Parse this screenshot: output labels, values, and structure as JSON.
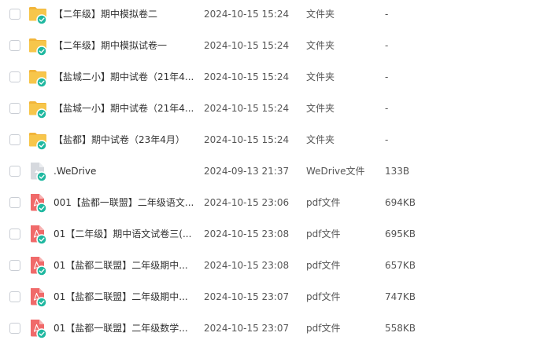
{
  "files": [
    {
      "name": "【二年级】期中模拟卷二",
      "date": "2024-10-15 15:24",
      "type": "文件夹",
      "size": "-",
      "icon": "folder-icon"
    },
    {
      "name": "【二年级】期中模拟试卷一",
      "date": "2024-10-15 15:24",
      "type": "文件夹",
      "size": "-",
      "icon": "folder-icon"
    },
    {
      "name": "【盐城二小】期中试卷（21年4...",
      "date": "2024-10-15 15:24",
      "type": "文件夹",
      "size": "-",
      "icon": "folder-icon"
    },
    {
      "name": "【盐城一小】期中试卷（21年4...",
      "date": "2024-10-15 15:24",
      "type": "文件夹",
      "size": "-",
      "icon": "folder-icon"
    },
    {
      "name": "【盐都】期中试卷（23年4月）",
      "date": "2024-10-15 15:24",
      "type": "文件夹",
      "size": "-",
      "icon": "folder-icon"
    },
    {
      "name": ".WeDrive",
      "date": "2024-09-13 21:37",
      "type": "WeDrive文件",
      "size": "133B",
      "icon": "generic-file-icon"
    },
    {
      "name": "001【盐都一联盟】二年级语文...",
      "date": "2024-10-15 23:06",
      "type": "pdf文件",
      "size": "694KB",
      "icon": "pdf-icon"
    },
    {
      "name": "01【二年级】期中语文试卷三(...",
      "date": "2024-10-15 23:08",
      "type": "pdf文件",
      "size": "695KB",
      "icon": "pdf-icon"
    },
    {
      "name": "01【盐都二联盟】二年级期中...",
      "date": "2024-10-15 23:08",
      "type": "pdf文件",
      "size": "657KB",
      "icon": "pdf-icon"
    },
    {
      "name": "01【盐都二联盟】二年级期中...",
      "date": "2024-10-15 23:07",
      "type": "pdf文件",
      "size": "747KB",
      "icon": "pdf-icon"
    },
    {
      "name": "01【盐都一联盟】二年级数学...",
      "date": "2024-10-15 23:07",
      "type": "pdf文件",
      "size": "558KB",
      "icon": "pdf-icon"
    }
  ],
  "colors": {
    "folder": "#f7c64b",
    "folder_tab": "#f2b53a",
    "pdf": "#f06a6a",
    "sync_badge": "#1fb8a0",
    "generic_file": "#d6d9de"
  }
}
